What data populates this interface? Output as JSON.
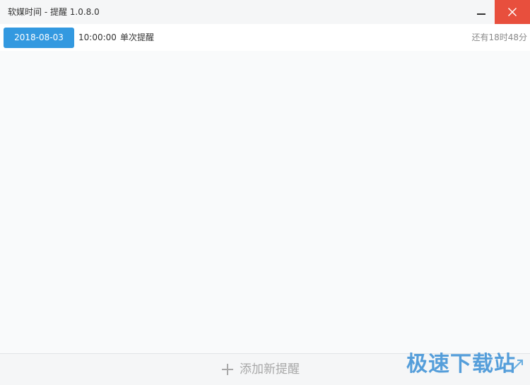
{
  "window": {
    "title": "软媒时间 - 提醒 1.0.8.0",
    "minimize_icon": "minimize-icon",
    "close_icon": "close-icon",
    "close_color": "#e84f3d"
  },
  "reminders": [
    {
      "date": "2018-08-03",
      "time": "10:00:00",
      "type": "单次提醒",
      "remaining": "还有18时48分"
    }
  ],
  "footer": {
    "add_icon": "plus-icon",
    "add_label": "添加新提醒"
  },
  "watermark": {
    "text": "极速下载站"
  },
  "colors": {
    "accent": "#3399e0",
    "close": "#e84f3d",
    "background": "#f9fafb"
  }
}
